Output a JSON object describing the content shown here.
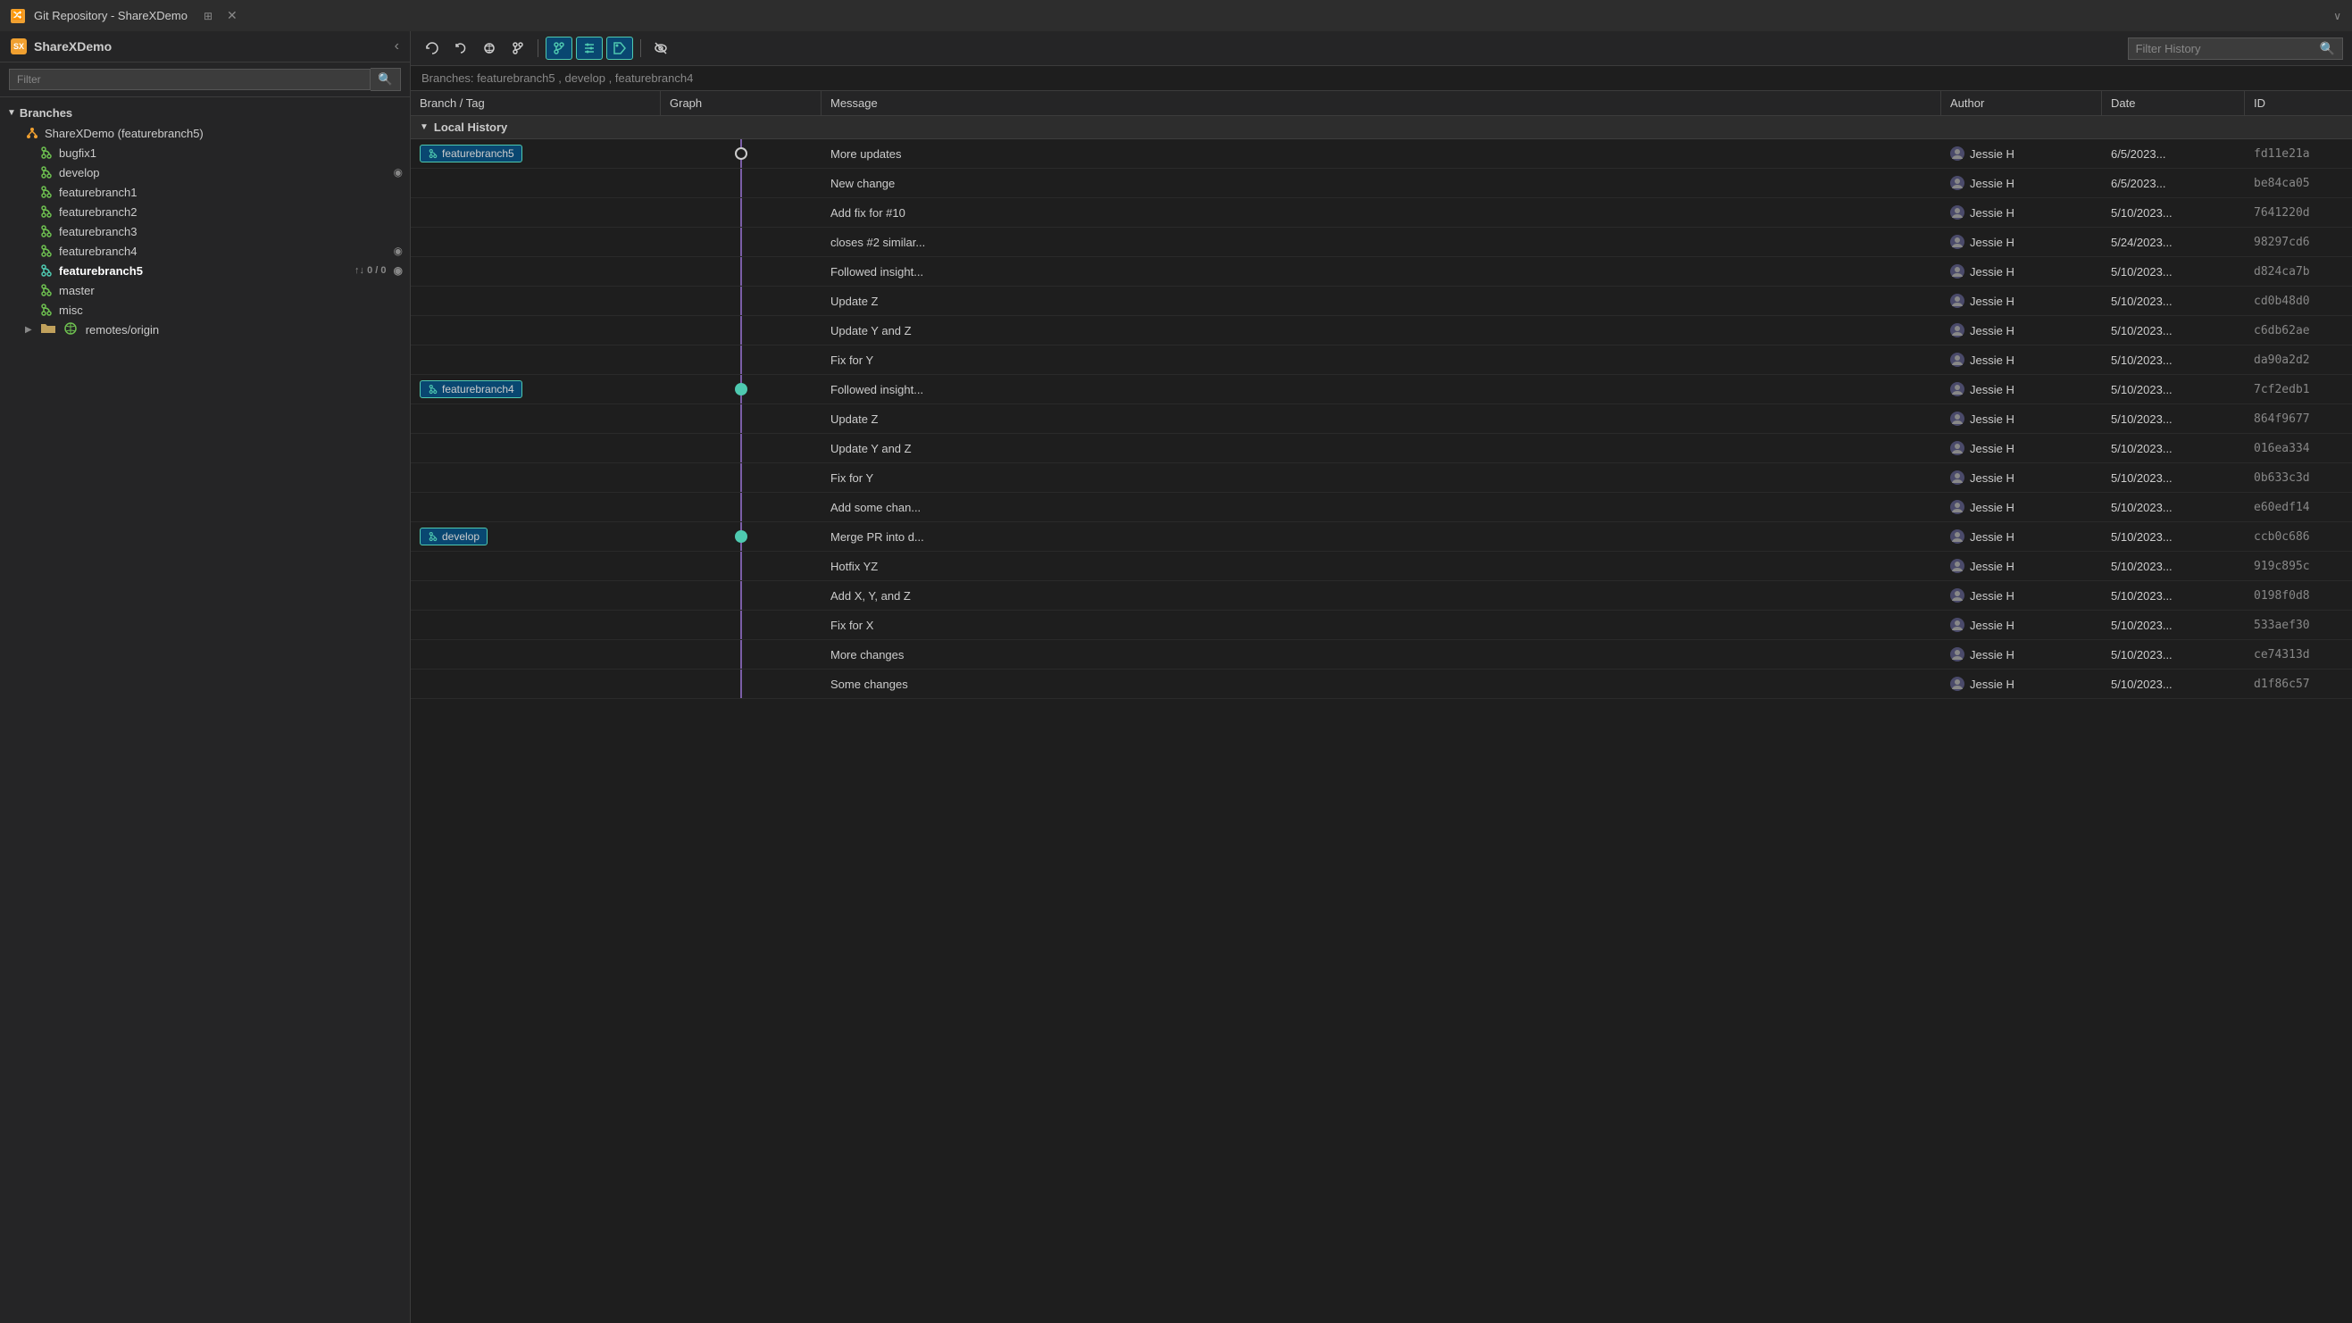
{
  "titleBar": {
    "icon": "🔀",
    "title": "Git Repository - ShareXDemo",
    "pin": "⊞",
    "close": "✕"
  },
  "sidebar": {
    "logo": "SX",
    "title": "ShareXDemo",
    "filterPlaceholder": "Filter",
    "sections": [
      {
        "label": "Branches",
        "expanded": true,
        "items": [
          {
            "name": "ShareXDemo (featurebranch5)",
            "type": "root",
            "active": false
          },
          {
            "name": "bugfix1",
            "type": "branch",
            "active": false
          },
          {
            "name": "develop",
            "type": "branch",
            "active": false,
            "hasEye": true
          },
          {
            "name": "featurebranch1",
            "type": "branch",
            "active": false
          },
          {
            "name": "featurebranch2",
            "type": "branch",
            "active": false
          },
          {
            "name": "featurebranch3",
            "type": "branch",
            "active": false
          },
          {
            "name": "featurebranch4",
            "type": "branch",
            "active": false,
            "hasEye": true
          },
          {
            "name": "featurebranch5",
            "type": "branch",
            "active": true,
            "sync": "↑↓ 0 / 0",
            "hasEye": true
          },
          {
            "name": "master",
            "type": "branch",
            "active": false
          },
          {
            "name": "misc",
            "type": "branch",
            "active": false
          },
          {
            "name": "remotes/origin",
            "type": "remote",
            "active": false
          }
        ]
      }
    ]
  },
  "toolbar": {
    "refreshLabel": "↺",
    "undoLabel": "↩",
    "fetchLabel": "⤓",
    "branchLabel": "⑂",
    "commitGraphLabel": "⑂",
    "tagLabel": "◇",
    "hideLabel": "👁",
    "filterPlaceholder": "Filter History"
  },
  "branchesLine": {
    "prefix": "Branches:",
    "branches": [
      "featurebranch5",
      "develop",
      "featurebranch4"
    ]
  },
  "table": {
    "headers": [
      "Branch / Tag",
      "Graph",
      "Message",
      "Author",
      "Date",
      "ID"
    ],
    "sectionLabel": "Local History",
    "rows": [
      {
        "branch": "featurebranch5",
        "showBranch": true,
        "graphDot": "empty",
        "message": "More updates",
        "author": "Jessie H",
        "date": "6/5/2023...",
        "id": "fd11e21a"
      },
      {
        "branch": "",
        "showBranch": false,
        "graphDot": "line",
        "message": "New change",
        "author": "Jessie H",
        "date": "6/5/2023...",
        "id": "be84ca05"
      },
      {
        "branch": "",
        "showBranch": false,
        "graphDot": "line",
        "message": "Add fix for #10",
        "author": "Jessie H",
        "date": "5/10/2023...",
        "id": "7641220d"
      },
      {
        "branch": "",
        "showBranch": false,
        "graphDot": "line",
        "message": "closes #2 similar...",
        "author": "Jessie H",
        "date": "5/24/2023...",
        "id": "98297cd6"
      },
      {
        "branch": "",
        "showBranch": false,
        "graphDot": "line",
        "message": "Followed insight...",
        "author": "Jessie H",
        "date": "5/10/2023...",
        "id": "d824ca7b"
      },
      {
        "branch": "",
        "showBranch": false,
        "graphDot": "line",
        "message": "Update Z",
        "author": "Jessie H",
        "date": "5/10/2023...",
        "id": "cd0b48d0"
      },
      {
        "branch": "",
        "showBranch": false,
        "graphDot": "line",
        "message": "Update Y and Z",
        "author": "Jessie H",
        "date": "5/10/2023...",
        "id": "c6db62ae"
      },
      {
        "branch": "",
        "showBranch": false,
        "graphDot": "line",
        "message": "Fix for Y",
        "author": "Jessie H",
        "date": "5/10/2023...",
        "id": "da90a2d2"
      },
      {
        "branch": "featurebranch4",
        "showBranch": true,
        "graphDot": "filled",
        "message": "Followed insight...",
        "author": "Jessie H",
        "date": "5/10/2023...",
        "id": "7cf2edb1"
      },
      {
        "branch": "",
        "showBranch": false,
        "graphDot": "line",
        "message": "Update Z",
        "author": "Jessie H",
        "date": "5/10/2023...",
        "id": "864f9677"
      },
      {
        "branch": "",
        "showBranch": false,
        "graphDot": "line",
        "message": "Update Y and Z",
        "author": "Jessie H",
        "date": "5/10/2023...",
        "id": "016ea334"
      },
      {
        "branch": "",
        "showBranch": false,
        "graphDot": "line",
        "message": "Fix for Y",
        "author": "Jessie H",
        "date": "5/10/2023...",
        "id": "0b633c3d"
      },
      {
        "branch": "",
        "showBranch": false,
        "graphDot": "line",
        "message": "Add some chan...",
        "author": "Jessie H",
        "date": "5/10/2023...",
        "id": "e60edf14"
      },
      {
        "branch": "develop",
        "showBranch": true,
        "graphDot": "filled",
        "message": "Merge PR into d...",
        "author": "Jessie H",
        "date": "5/10/2023...",
        "id": "ccb0c686"
      },
      {
        "branch": "",
        "showBranch": false,
        "graphDot": "line",
        "message": "Hotfix YZ",
        "author": "Jessie H",
        "date": "5/10/2023...",
        "id": "919c895c"
      },
      {
        "branch": "",
        "showBranch": false,
        "graphDot": "line",
        "message": "Add X, Y, and Z",
        "author": "Jessie H",
        "date": "5/10/2023...",
        "id": "0198f0d8"
      },
      {
        "branch": "",
        "showBranch": false,
        "graphDot": "line",
        "message": "Fix for X",
        "author": "Jessie H",
        "date": "5/10/2023...",
        "id": "533aef30"
      },
      {
        "branch": "",
        "showBranch": false,
        "graphDot": "line",
        "message": "More changes",
        "author": "Jessie H",
        "date": "5/10/2023...",
        "id": "ce74313d"
      },
      {
        "branch": "",
        "showBranch": false,
        "graphDot": "line",
        "message": "Some changes",
        "author": "Jessie H",
        "date": "5/10/2023...",
        "id": "d1f86c57"
      }
    ]
  },
  "colors": {
    "accent": "#4ec9b0",
    "branchLine": "#7b5ea7",
    "dotFilled": "#4ec9b0",
    "dotEmpty": "#cccccc",
    "badge": "#094771"
  }
}
